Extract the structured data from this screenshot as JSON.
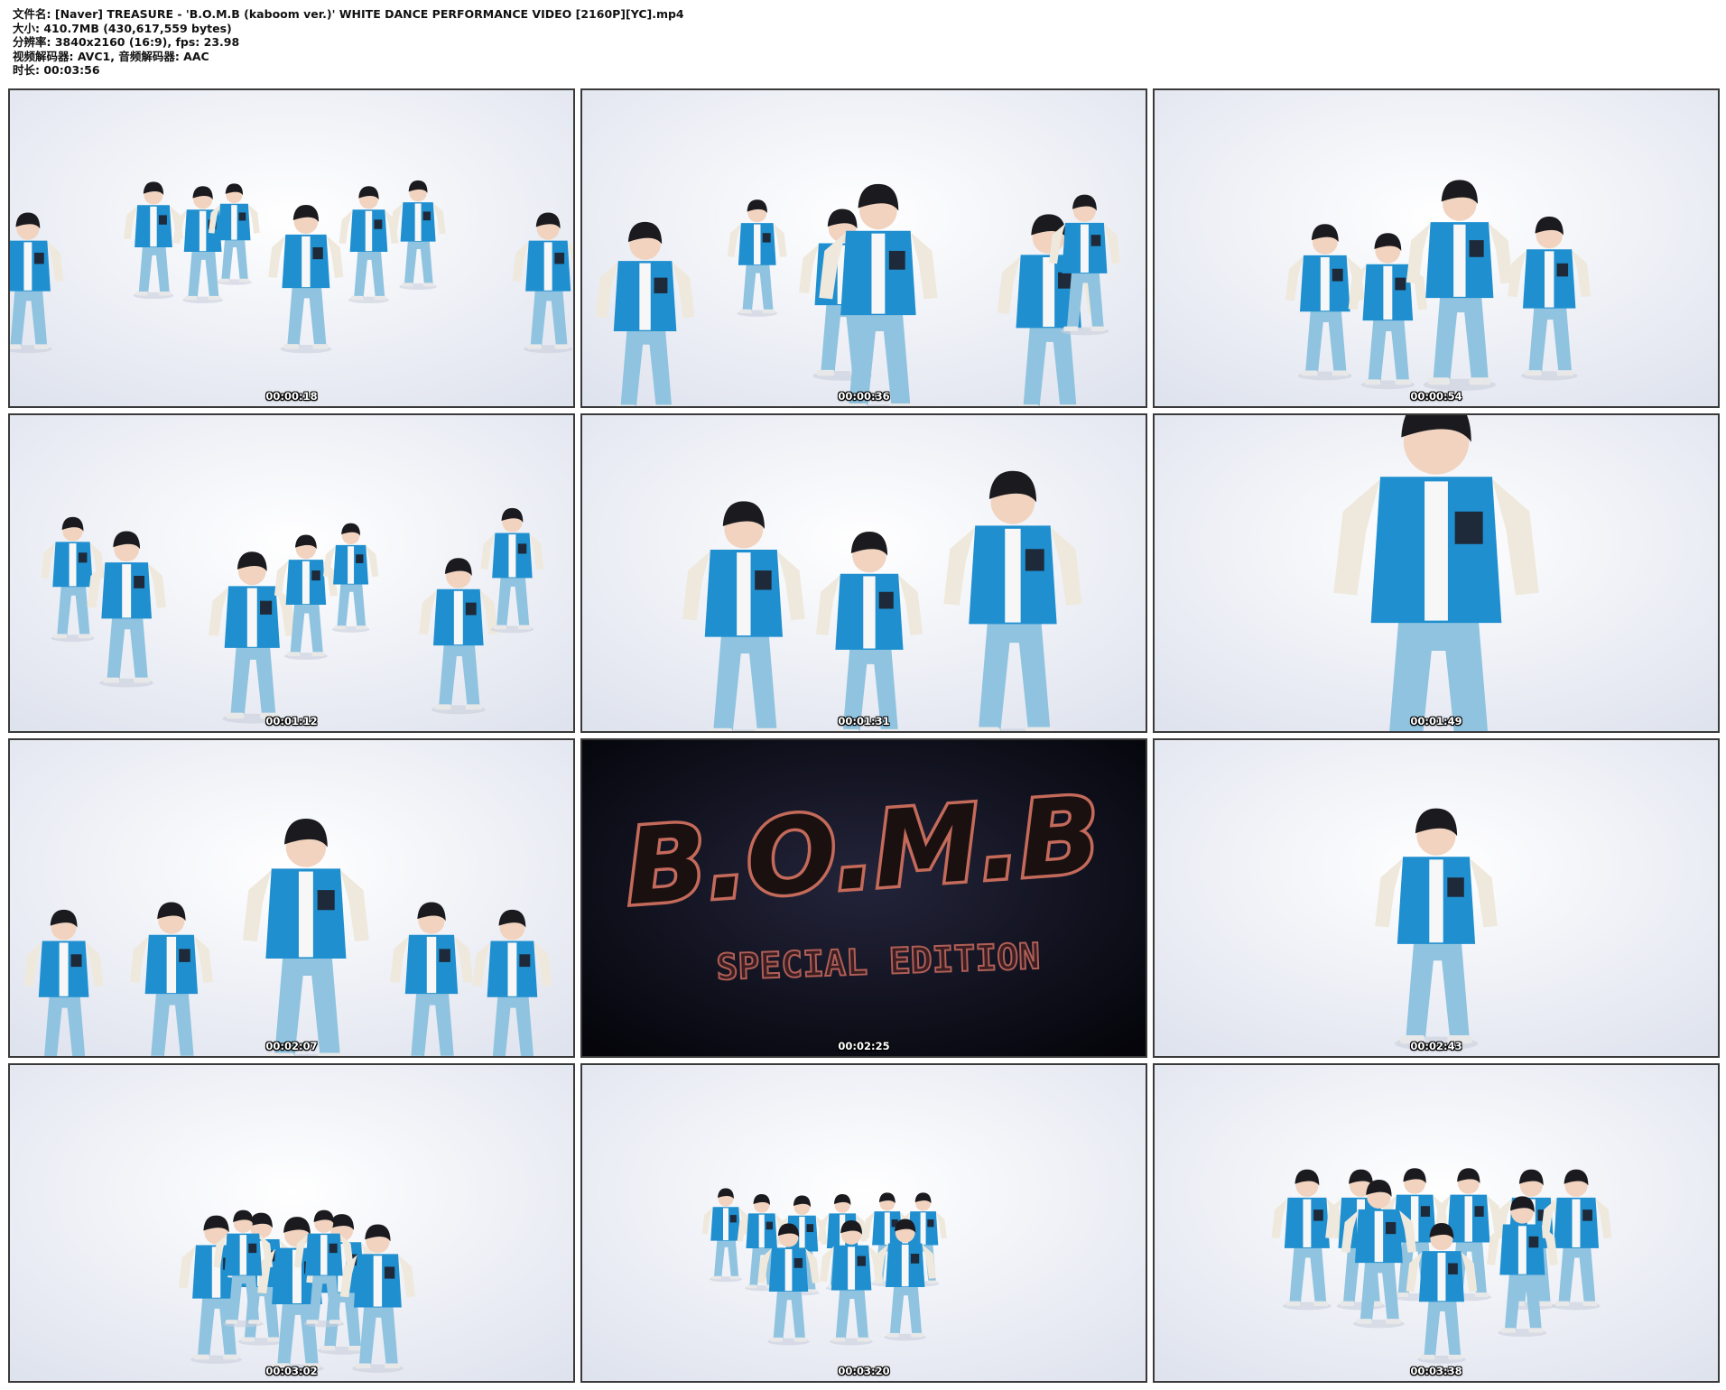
{
  "header": {
    "file_name": "文件名: [Naver] TREASURE - 'B.O.M.B (kaboom ver.)' WHITE DANCE PERFORMANCE VIDEO [2160P][YC].mp4",
    "size": "大小: 410.7MB (430,617,559 bytes)",
    "resolution": "分辨率: 3840x2160 (16:9), fps: 23.98",
    "codec": "视频解码器: AVC1, 音频解码器: AAC",
    "duration": "时长: 00:03:56"
  },
  "colors": {
    "jacket_blue": "#1f8fd0",
    "sleeve_cream": "#efe8dc",
    "denim": "#8fc3e0",
    "studio_white": "#eef0f6",
    "dark_frame": "#0d0d18",
    "logo_red": "#c46a5a"
  },
  "thumbnails": [
    {
      "timestamp": "00:00:18",
      "scene": "wide"
    },
    {
      "timestamp": "00:00:36",
      "scene": "group-close"
    },
    {
      "timestamp": "00:00:54",
      "scene": "group-mid"
    },
    {
      "timestamp": "00:01:12",
      "scene": "wide-pointing"
    },
    {
      "timestamp": "00:01:31",
      "scene": "trio"
    },
    {
      "timestamp": "00:01:49",
      "scene": "closeup"
    },
    {
      "timestamp": "00:02:07",
      "scene": "heart-hands"
    },
    {
      "timestamp": "00:02:25",
      "scene": "logo",
      "logo_text": "B.O.M.B",
      "logo_sub": "SPECIAL EDITION"
    },
    {
      "timestamp": "00:02:43",
      "scene": "solo"
    },
    {
      "timestamp": "00:03:02",
      "scene": "huddle"
    },
    {
      "timestamp": "00:03:20",
      "scene": "formation"
    },
    {
      "timestamp": "00:03:38",
      "scene": "pose-group"
    }
  ]
}
